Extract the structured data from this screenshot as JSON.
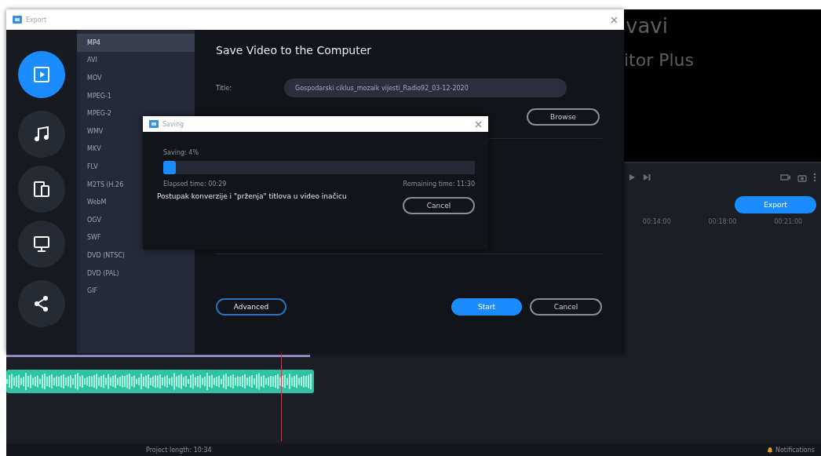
{
  "editor": {
    "preview_lines": [
      "vavi",
      "itor Plus"
    ],
    "export_button": "Export",
    "timeline_labels": [
      "00:14:00",
      "00:18:00",
      "00:21:00"
    ],
    "status": {
      "project_length": "Project length: 10:34",
      "notifications": "Notifications"
    }
  },
  "export_window": {
    "title": "Export",
    "categories": [
      {
        "kind": "video",
        "selected": true
      },
      {
        "kind": "audio",
        "selected": false
      },
      {
        "kind": "devices",
        "selected": false
      },
      {
        "kind": "tv",
        "selected": false
      },
      {
        "kind": "share",
        "selected": false
      }
    ],
    "formats": [
      {
        "label": "MP4",
        "selected": true
      },
      {
        "label": "AVI",
        "selected": false
      },
      {
        "label": "MOV",
        "selected": false
      },
      {
        "label": "MPEG-1",
        "selected": false
      },
      {
        "label": "MPEG-2",
        "selected": false
      },
      {
        "label": "WMV",
        "selected": false
      },
      {
        "label": "MKV",
        "selected": false
      },
      {
        "label": "FLV",
        "selected": false
      },
      {
        "label": "M2TS (H.26",
        "selected": false
      },
      {
        "label": "WebM",
        "selected": false
      },
      {
        "label": "OGV",
        "selected": false
      },
      {
        "label": "SWF",
        "selected": false
      },
      {
        "label": "DVD (NTSC)",
        "selected": false
      },
      {
        "label": "DVD (PAL)",
        "selected": false
      },
      {
        "label": "GIF",
        "selected": false
      }
    ],
    "heading": "Save Video to the Computer",
    "title_label": "Title:",
    "title_value": "Gospodarski ciklus_mozaik vijesti_Radio92_03-12-2020",
    "browse": "Browse",
    "buttons": [
      {
        "label": "Advanced",
        "kind": "outline-blue"
      },
      {
        "label": "Start",
        "kind": "primary"
      },
      {
        "label": "Cancel",
        "kind": "outline"
      }
    ]
  },
  "saving_dialog": {
    "title": "Saving",
    "status": "Saving: 4%",
    "level": 0.04,
    "elapsed": "Elapsed time: 00:29",
    "remaining": "Remaining time: 11:30",
    "message": "Postupak konverzije i \"prženja\" titlova u video inačicu",
    "cancel": "Cancel"
  }
}
